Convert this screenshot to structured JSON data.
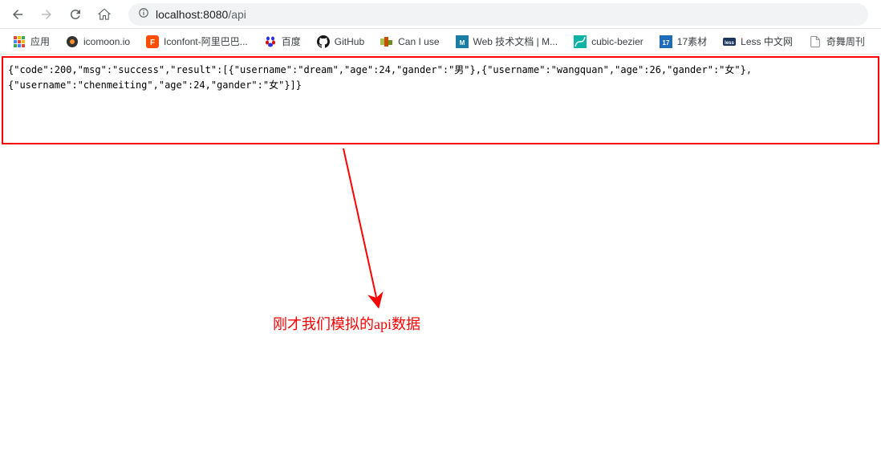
{
  "url": {
    "host": "localhost:",
    "port": "8080",
    "path": "/api"
  },
  "bookmarks": {
    "apps": "应用",
    "items": [
      {
        "label": "icomoon.io"
      },
      {
        "label": "Iconfont-阿里巴巴..."
      },
      {
        "label": "百度"
      },
      {
        "label": "GitHub"
      },
      {
        "label": "Can I use"
      },
      {
        "label": "Web 技术文档 | M..."
      },
      {
        "label": "cubic-bezier"
      },
      {
        "label": "17素材"
      },
      {
        "label": "Less 中文网"
      },
      {
        "label": "奇舞周刊"
      }
    ]
  },
  "response_line1": "{\"code\":200,\"msg\":\"success\",\"result\":[{\"username\":\"dream\",\"age\":24,\"gander\":\"男\"},{\"username\":\"wangquan\",\"age\":26,\"gander\":\"女\"},",
  "response_line2": "{\"username\":\"chenmeiting\",\"age\":24,\"gander\":\"女\"}]}",
  "annotation": "刚才我们模拟的api数据"
}
